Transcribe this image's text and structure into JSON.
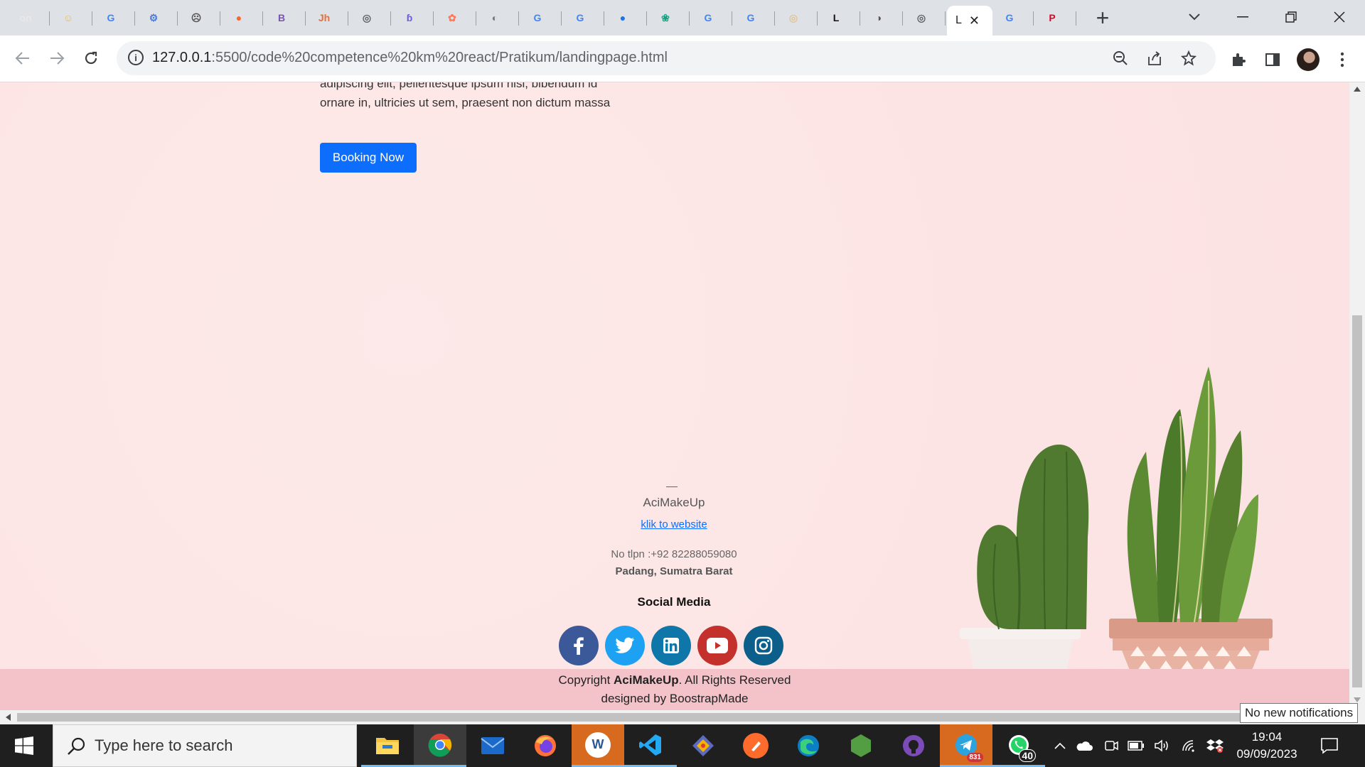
{
  "browser": {
    "active_tab_title": "L",
    "url_host": "127.0.0.1",
    "url_path": ":5500/code%20competence%20km%20react/Pratikum/landingpage.html",
    "tabs": [
      {
        "icon": "onenote-icon",
        "glyph": "on",
        "color": "#e8e8e8"
      },
      {
        "icon": "drawing-icon",
        "glyph": "☺",
        "color": "#e8c25a"
      },
      {
        "icon": "google-icon",
        "glyph": "G",
        "color": "#4285f4"
      },
      {
        "icon": "bot-icon",
        "glyph": "⚙",
        "color": "#4a7bd8"
      },
      {
        "icon": "face-icon",
        "glyph": "☹",
        "color": "#555"
      },
      {
        "icon": "semrush-icon",
        "glyph": "●",
        "color": "#ff642d"
      },
      {
        "icon": "bootstrap-icon",
        "glyph": "B",
        "color": "#7952b3"
      },
      {
        "icon": "jh-icon",
        "glyph": "Jh",
        "color": "#e86f3c"
      },
      {
        "icon": "chrome-icon",
        "glyph": "◎",
        "color": "#5f6368"
      },
      {
        "icon": "swirl-icon",
        "glyph": "ɓ",
        "color": "#6b5ce7"
      },
      {
        "icon": "hubspot-icon",
        "glyph": "✿",
        "color": "#ff7a59"
      },
      {
        "icon": "globe-icon",
        "glyph": "◐",
        "color": "#777"
      },
      {
        "icon": "google-icon",
        "glyph": "G",
        "color": "#4285f4"
      },
      {
        "icon": "google-icon",
        "glyph": "G",
        "color": "#4285f4"
      },
      {
        "icon": "blue-circle-icon",
        "glyph": "●",
        "color": "#1a73e8"
      },
      {
        "icon": "chatgpt-icon",
        "glyph": "❀",
        "color": "#10a37f"
      },
      {
        "icon": "google-icon",
        "glyph": "G",
        "color": "#4285f4"
      },
      {
        "icon": "google-icon",
        "glyph": "G",
        "color": "#4285f4"
      },
      {
        "icon": "globe-icon",
        "glyph": "◎",
        "color": "#e0c49a"
      },
      {
        "icon": "letter-l-icon",
        "glyph": "L",
        "color": "#111"
      },
      {
        "icon": "globe-icon",
        "glyph": "◑",
        "color": "#555"
      },
      {
        "icon": "chrome-icon",
        "glyph": "◎",
        "color": "#5f6368"
      },
      {
        "icon": "google-icon",
        "glyph": "G",
        "color": "#4285f4"
      },
      {
        "icon": "pinterest-icon",
        "glyph": "P",
        "color": "#e60023"
      }
    ]
  },
  "page": {
    "hero_text": "adipiscing elit, pellentesque ipsum nisi, bibendum id ornare in, ultricies ut sem, praesent non dictum massa",
    "booking_button": "Booking Now",
    "footer": {
      "dash": "—",
      "brand": "AciMakeUp",
      "link": "klik to website",
      "phone": "No tlpn :+92 82288059080",
      "address": "Padang, Sumatra Barat",
      "social_title": "Social Media",
      "social": [
        {
          "name": "facebook",
          "glyph": "f",
          "color": "#3b5998"
        },
        {
          "name": "twitter",
          "glyph": "t",
          "color": "#1da1f2"
        },
        {
          "name": "linkedin",
          "glyph": "in",
          "color": "#0e76a8"
        },
        {
          "name": "youtube",
          "glyph": "▶",
          "color": "#c4302b"
        },
        {
          "name": "instagram",
          "glyph": "ig",
          "color": "#0b5f8a"
        }
      ],
      "copyright_prefix": "Copyright ",
      "copyright_brand": "AciMakeUp",
      "copyright_suffix": ". All Rights Reserved",
      "designed_by": "designed by BoostrapMade"
    }
  },
  "system": {
    "notification_tooltip": "No new notifications",
    "search_placeholder": "Type here to search",
    "time": "19:04",
    "date": "09/09/2023",
    "telegram_badge": "831",
    "whatsapp_badge": "40"
  }
}
